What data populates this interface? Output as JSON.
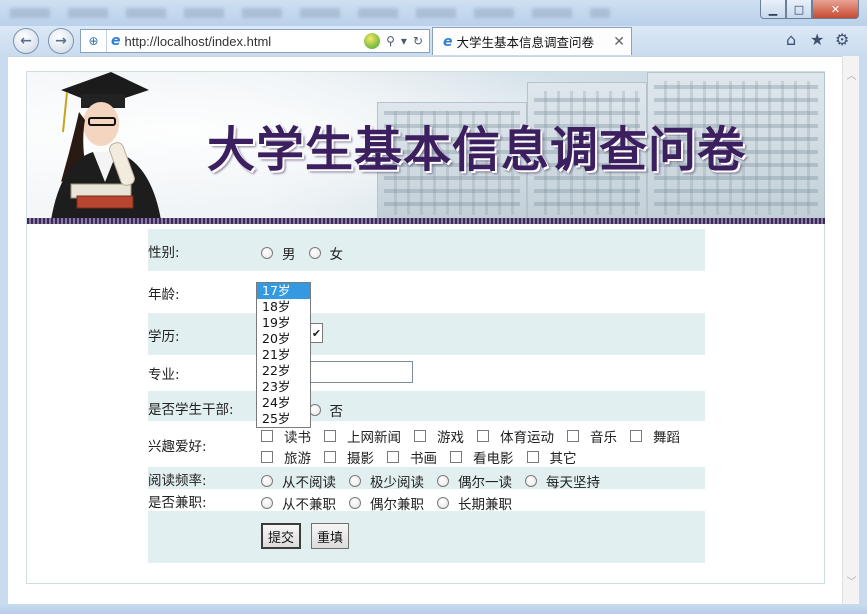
{
  "browser": {
    "url": "http://localhost/index.html",
    "tab_title": "大学生基本信息调查问卷",
    "tab_close": "✕",
    "window_buttons": {
      "minimize": "▁",
      "maximize": "□",
      "close": "✕"
    }
  },
  "banner": {
    "title": "大学生基本信息调查问卷"
  },
  "form": {
    "gender": {
      "label": "性别:",
      "options": [
        "男",
        "女"
      ]
    },
    "age": {
      "label": "年龄:",
      "options": [
        "17岁",
        "18岁",
        "19岁",
        "20岁",
        "21岁",
        "22岁",
        "23岁",
        "24岁",
        "25岁"
      ],
      "selected": "17岁"
    },
    "education": {
      "label": "学历:"
    },
    "major": {
      "label": "专业:",
      "value": ""
    },
    "cadre": {
      "label": "是否学生干部:",
      "options": [
        "是",
        "否"
      ]
    },
    "hobbies": {
      "label": "兴趣爱好:",
      "row1": [
        "读书",
        "上网新闻",
        "游戏",
        "体育运动",
        "音乐",
        "舞蹈"
      ],
      "row2": [
        "旅游",
        "摄影",
        "书画",
        "看电影",
        "其它"
      ]
    },
    "reading": {
      "label": "阅读频率:",
      "options": [
        "从不阅读",
        "极少阅读",
        "偶尔一读",
        "每天坚持"
      ]
    },
    "parttime": {
      "label": "是否兼职:",
      "options": [
        "从不兼职",
        "偶尔兼职",
        "长期兼职"
      ]
    },
    "submit_label": "提交",
    "reset_label": "重填"
  },
  "colors": {
    "row_shade": "#e2eff0",
    "banner_title": "#3b1f5e",
    "dropdown_selected": "#3399e0"
  }
}
